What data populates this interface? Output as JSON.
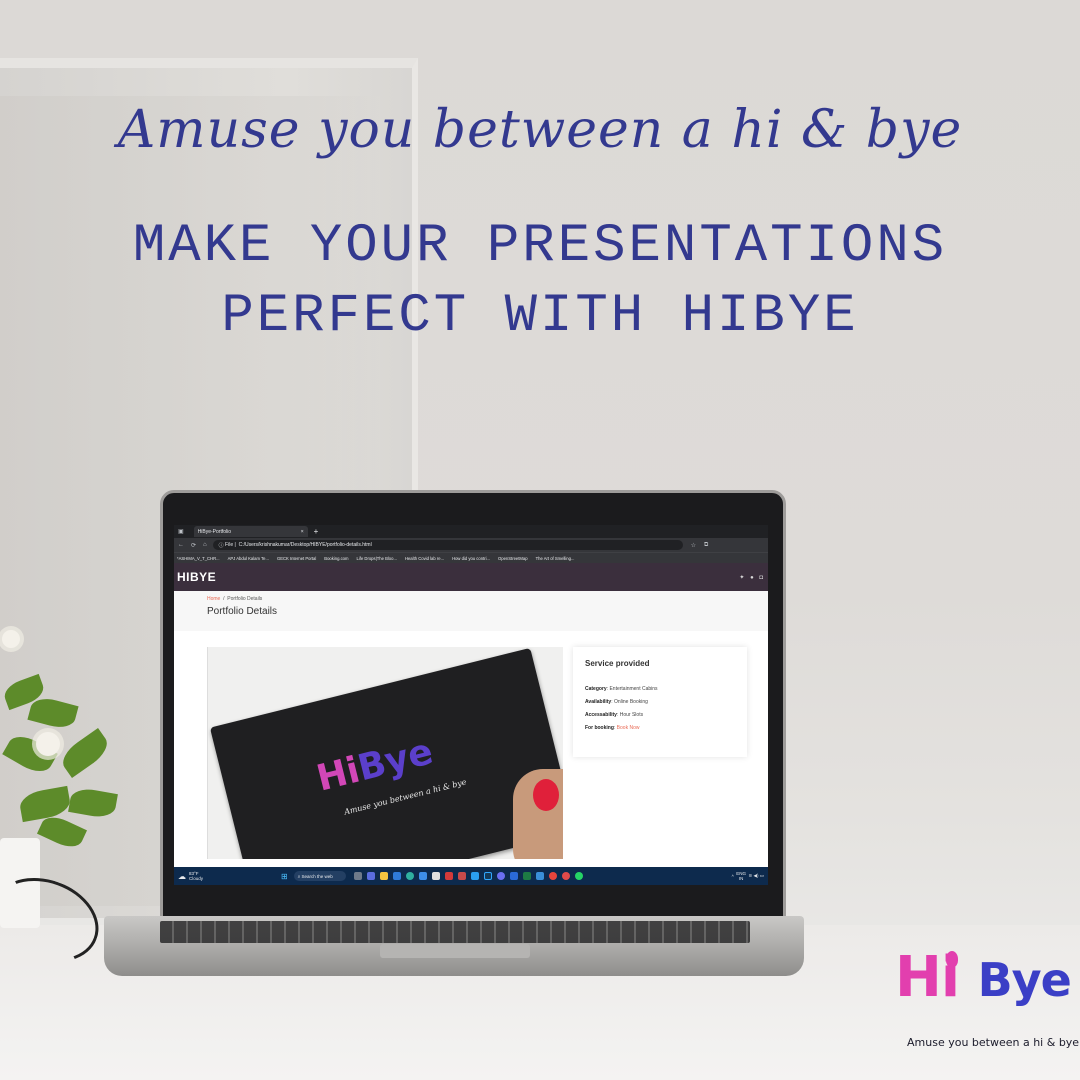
{
  "poster": {
    "script_headline": "Amuse you between a hi & bye",
    "main_headline_line1": "MAKE YOUR PRESENTATIONS",
    "main_headline_line2": "PERFECT WITH HIBYE",
    "brand_hi": "Hi",
    "brand_bye": "Bye",
    "brand_tagline": "Amuse you between a hi & bye",
    "brand_pink": "#e23fae",
    "brand_blue": "#3b3fc6"
  },
  "browser": {
    "tab_title": "HiBye-Portfolio",
    "tab_close": "×",
    "tab_new": "+",
    "address_prefix": "File",
    "address": "C:/Users/krishnakumar/Desktop/HIBYE/portfolio-details.html",
    "bookmarks": [
      "*ASHIMA_V_T_CHR...",
      "APJ Abdul Kalam Te...",
      "GECK Internet Portal",
      "Booking.com",
      "Life Drops|The Bloo...",
      "Health Covid lab re...",
      "How did you contri...",
      "OpenStreetMap",
      "The Art of Smelling..."
    ]
  },
  "site": {
    "logo": "HIBYE",
    "social_icons": [
      "twitter-icon",
      "facebook-icon",
      "instagram-icon"
    ],
    "breadcrumb_home": "Home",
    "breadcrumb_sep": "/",
    "breadcrumb_current": "Portfolio Details",
    "page_title": "Portfolio Details",
    "card_logo_hi": "Hi",
    "card_logo_bye": "Bye",
    "card_tagline": "Amuse you between a hi & bye",
    "service": {
      "title": "Service provided",
      "category_label": "Category",
      "category_value": ": Entertainment Cabins",
      "availability_label": "Availability",
      "availability_value": ": Online Booking",
      "accessability_label": "Accessability",
      "accessability_value": ": Hour Slots",
      "booking_label": "For booking",
      "booking_sep": ": ",
      "booking_link": "Book Now"
    }
  },
  "taskbar": {
    "temperature": "83°F",
    "condition": "Cloudy",
    "search_label": "Search the web",
    "lang_top": "ENG",
    "lang_bottom": "IN"
  }
}
